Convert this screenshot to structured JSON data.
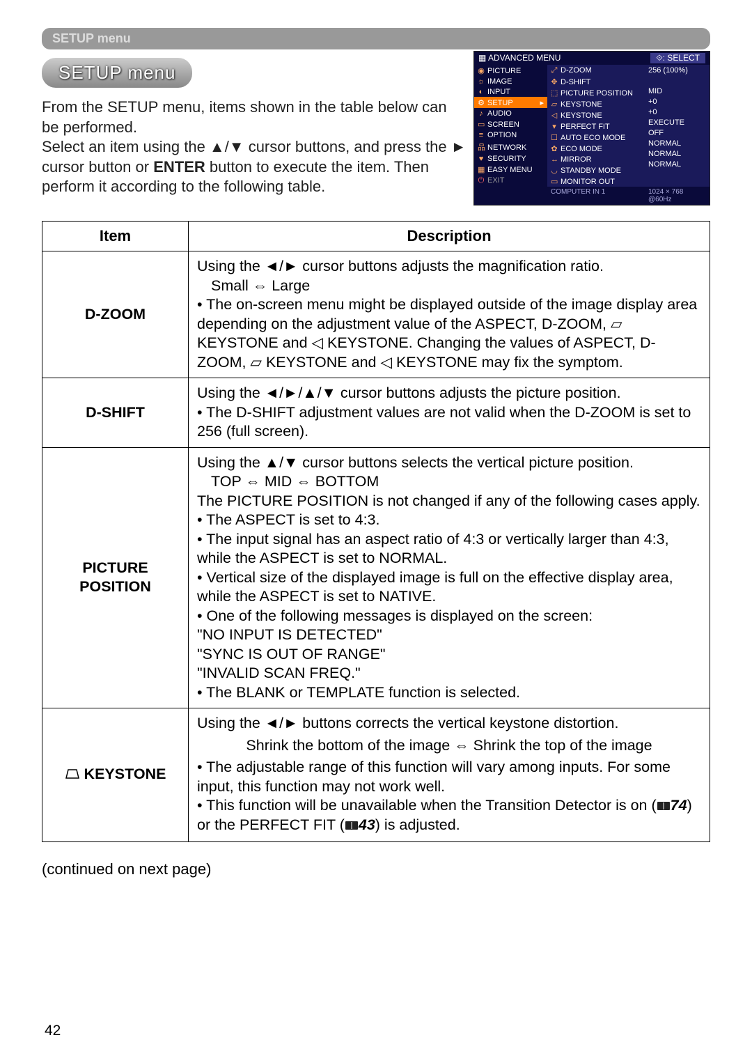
{
  "breadcrumb": "SETUP menu",
  "title_chip": "SETUP menu",
  "intro_p1": "From the SETUP menu, items shown in the table below can be performed.",
  "intro_p2a": "Select an item using the ▲/▼ cursor buttons, and press the ► cursor button or ",
  "intro_p2b": "ENTER",
  "intro_p2c": " button to execute the item. Then perform it according to the following table.",
  "onscreen": {
    "header_left": "ADVANCED MENU",
    "header_right": "⟐: SELECT",
    "left": [
      "PICTURE",
      "IMAGE",
      "INPUT",
      "SETUP",
      "AUDIO",
      "SCREEN",
      "OPTION",
      "NETWORK",
      "SECURITY",
      "EASY MENU",
      "EXIT"
    ],
    "middle": [
      "D-ZOOM",
      "D-SHIFT",
      "PICTURE POSITION",
      "KEYSTONE",
      "KEYSTONE",
      "PERFECT FIT",
      "AUTO ECO MODE",
      "ECO MODE",
      "MIRROR",
      "STANDBY MODE",
      "MONITOR OUT"
    ],
    "right": [
      "256 (100%)",
      "",
      "MID",
      "+0",
      "+0",
      "EXECUTE",
      "OFF",
      "NORMAL",
      "NORMAL",
      "NORMAL",
      ""
    ],
    "footer_mid": "COMPUTER IN 1",
    "footer_right": "1024 × 768 @60Hz"
  },
  "table": {
    "h1": "Item",
    "h2": "Description",
    "rows": [
      {
        "item": "D-ZOOM",
        "desc_l1": "Using the ◄/► cursor buttons adjusts the magnification ratio.",
        "desc_l2": "Small ⇔ Large",
        "desc_l3": "• The on-screen menu might be displayed outside of the image display area depending on the adjustment value of the ASPECT, D-ZOOM, ▱ KEYSTONE and ◁ KEYSTONE. Changing the values of ASPECT, D-ZOOM, ▱ KEYSTONE and ◁ KEYSTONE  may fix the symptom."
      },
      {
        "item": "D-SHIFT",
        "desc": "Using the ◄/►/▲/▼ cursor buttons adjusts the picture position.\n• The D-SHIFT adjustment values are not valid when the D-ZOOM is set to 256 (full screen)."
      },
      {
        "item": "PICTURE POSITION",
        "desc_l1": "Using the ▲/▼ cursor buttons selects the vertical picture position.",
        "desc_l2": "TOP ⇔ MID ⇔ BOTTOM",
        "desc_rest": "The PICTURE POSITION is not changed if any of the following cases apply.\n• The ASPECT is set to 4:3.\n• The input signal has an aspect ratio of 4:3 or vertically larger than 4:3, while the ASPECT is set to NORMAL.\n• Vertical size of the displayed image is full on the effective display area, while the ASPECT is set to NATIVE.\n• One of the following messages is displayed on the screen:\n\"NO INPUT IS DETECTED\"\n\"SYNC IS OUT OF RANGE\"\n\"INVALID SCAN FREQ.\"\n• The BLANK or TEMPLATE function is selected."
      },
      {
        "item_prefix": "▱ ",
        "item": "KEYSTONE",
        "desc_l1": "Using the ◄/► buttons corrects the vertical keystone distortion.",
        "desc_l2": "Shrink the bottom of the image ⇔ Shrink the top of the image",
        "desc_rest_a": "• The adjustable range of this function will vary among inputs. For some input, this function may not work well.\n• This function will be unavailable when the Transition Detector is on (",
        "ref1_icon": "📖",
        "ref1": "74",
        "desc_rest_b": ") or the PERFECT FIT (",
        "ref2_icon": "📖",
        "ref2": "43",
        "desc_rest_c": ") is adjusted."
      }
    ]
  },
  "continued": "(continued on next page)",
  "page_number": "42"
}
